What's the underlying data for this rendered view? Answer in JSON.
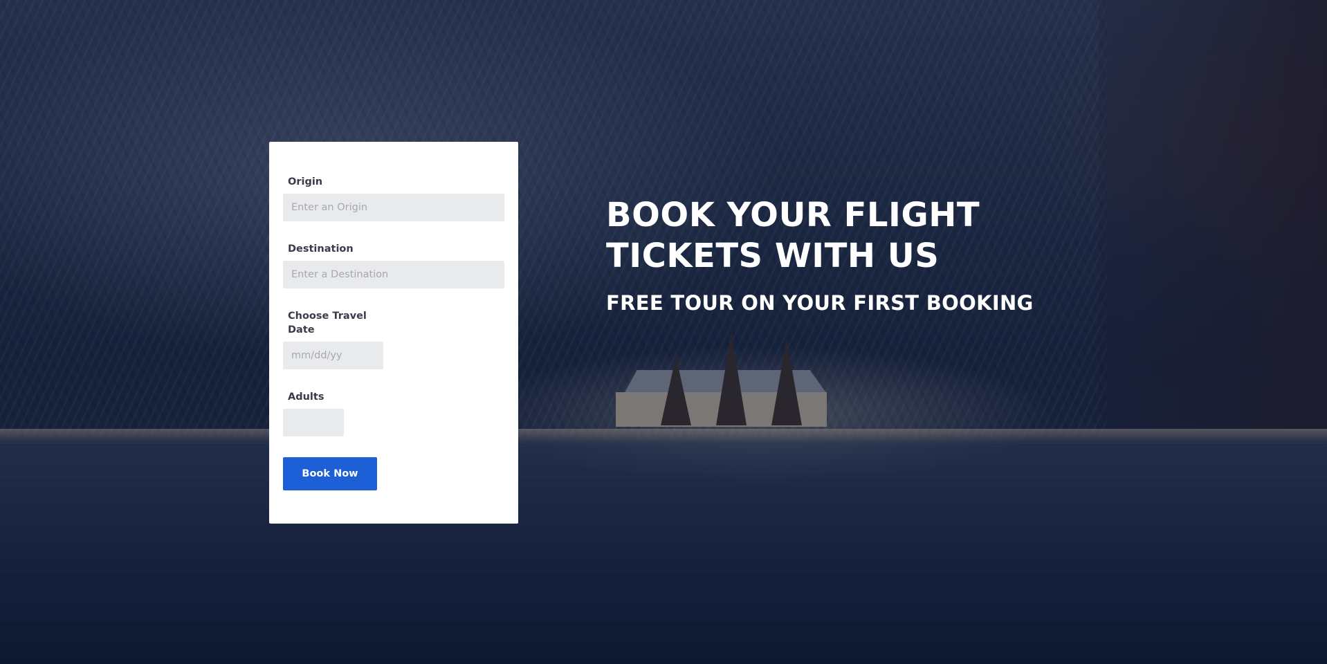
{
  "form": {
    "origin": {
      "label": "Origin",
      "placeholder": "Enter an Origin",
      "value": ""
    },
    "destination": {
      "label": "Destination",
      "placeholder": "Enter a Destination",
      "value": ""
    },
    "travel_date": {
      "label": "Choose Travel Date",
      "placeholder": "mm/dd/yy",
      "value": ""
    },
    "adults": {
      "label": "Adults",
      "value": ""
    },
    "submit_label": "Book Now"
  },
  "hero": {
    "title": "BOOK YOUR FLIGHT TICKETS WITH US",
    "subtitle": "FREE TOUR ON YOUR FIRST BOOKING"
  },
  "colors": {
    "button": "#1d5fd6",
    "input_bg": "#e9eaec",
    "card_bg": "#ffffff",
    "text_white": "#ffffff",
    "label": "#3a3b4a"
  }
}
